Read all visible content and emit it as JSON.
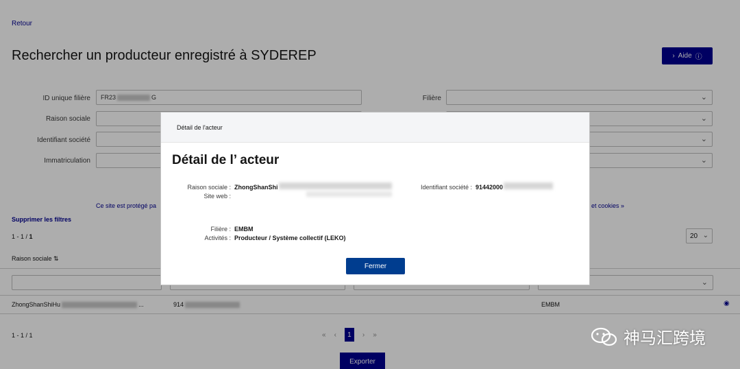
{
  "header": {
    "back": "Retour",
    "title": "Rechercher un producteur enregistré à SYDEREP",
    "help": "Aide"
  },
  "filters": {
    "id_label": "ID unique filière",
    "id_value_prefix": "FR23",
    "id_value_suffix": "G",
    "raison_label": "Raison sociale",
    "identifiant_label": "Identifiant société",
    "immat_label": "Immatriculation",
    "filiere_label": "Filière"
  },
  "notice": {
    "left": "Ce site est protégé pa",
    "right": "et cookies »"
  },
  "results": {
    "clear_filters": "Supprimer les filtres",
    "count_prefix": "1 - 1 / ",
    "count_total": "1",
    "page_size": "20",
    "column_raison": "Raison sociale",
    "sort_icon": "⇅",
    "row": {
      "raison": "ZhongShanShiHu",
      "raison_tail": "...",
      "identifiant": "914",
      "filiere": "EMBM"
    },
    "bottom_count": "1 - 1 / 1"
  },
  "pager": {
    "first": "«",
    "prev": "‹",
    "current": "1",
    "next": "›",
    "last": "»"
  },
  "export": "Exporter",
  "modal": {
    "header": "Détail de l'acteur",
    "title": "Détail de l’ acteur",
    "raison_label": "Raison sociale :",
    "raison_value": "ZhongShanShi",
    "site_label": "Site web :",
    "identifiant_label": "Identifiant société :",
    "identifiant_value": "91442000",
    "filiere_label": "Filière :",
    "filiere_value": "EMBM",
    "activites_label": "Activités :",
    "activites_value": "Producteur / Système collectif (LEKO)",
    "close": "Fermer"
  },
  "watermark": "神马汇跨境",
  "colors": {
    "primary": "#000091",
    "button": "#003d8f"
  }
}
